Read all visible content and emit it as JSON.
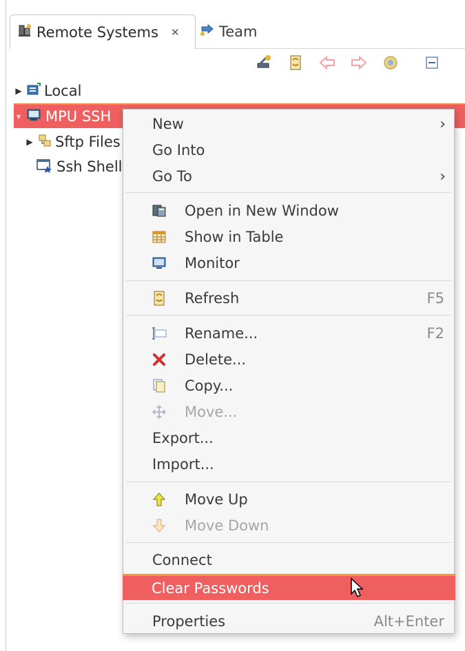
{
  "tabs": {
    "active_label": "Remote Systems",
    "close_glyph": "✕",
    "inactive_label": "Team"
  },
  "tree": {
    "local": "Local",
    "mpu_ssh": "MPU SSH",
    "sftp": "Sftp Files",
    "ssh_shells": "Ssh Shells"
  },
  "menu": {
    "new": "New",
    "go_into": "Go Into",
    "go_to": "Go To",
    "open_new_window": "Open in New Window",
    "show_in_table": "Show in Table",
    "monitor": "Monitor",
    "refresh": "Refresh",
    "refresh_accel": "F5",
    "rename": "Rename...",
    "rename_accel": "F2",
    "delete": "Delete...",
    "copy": "Copy...",
    "move": "Move...",
    "export": "Export...",
    "import": "Import...",
    "move_up": "Move Up",
    "move_down": "Move Down",
    "connect": "Connect",
    "clear_passwords": "Clear Passwords",
    "properties": "Properties",
    "properties_accel": "Alt+Enter",
    "submenu_glyph": "›"
  },
  "colors": {
    "selection": "#ef5f5f",
    "selection_border": "#f39a3e",
    "menu_bg": "#f6f6f6"
  }
}
